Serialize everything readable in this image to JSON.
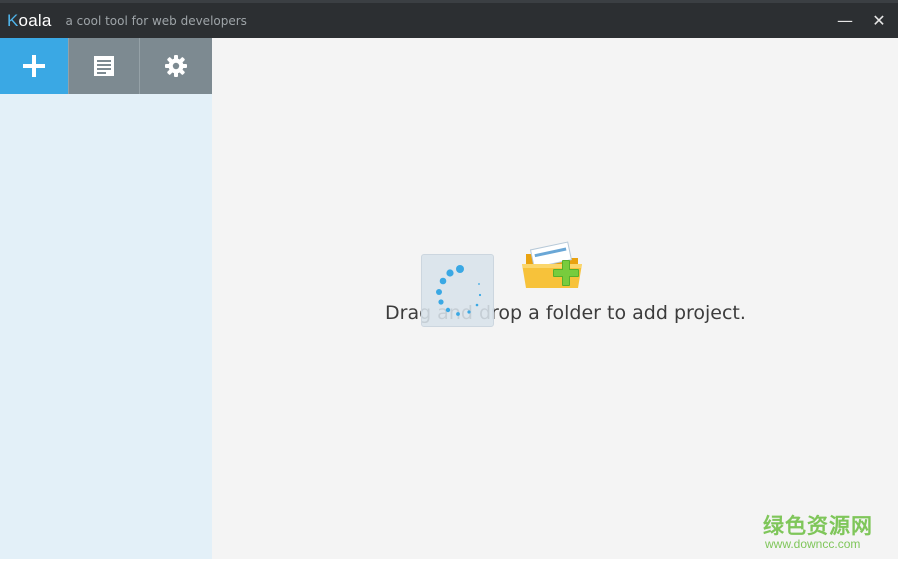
{
  "window": {
    "app_name_first": "K",
    "app_name_rest": "oala",
    "tagline": "a cool tool for web developers",
    "minimize_glyph": "—",
    "close_glyph": "✕"
  },
  "toolbar": {
    "buttons": [
      {
        "icon": "plus-icon"
      },
      {
        "icon": "log-document-icon"
      },
      {
        "icon": "gear-icon"
      }
    ]
  },
  "main": {
    "drop_hint": "Drag and drop a folder to add project.",
    "folder_icon": "folder-add-icon",
    "spinner_icon": "loading-spinner-icon"
  },
  "watermark": {
    "cn": "绿色资源网",
    "url": "www.downcc.com"
  },
  "colors": {
    "titlebar": "#2c2f32",
    "accent": "#3aa8e4",
    "toolbar_gray": "#7d8a91",
    "sidebar": "#e3f0f8",
    "watermark": "#7fc65a"
  }
}
